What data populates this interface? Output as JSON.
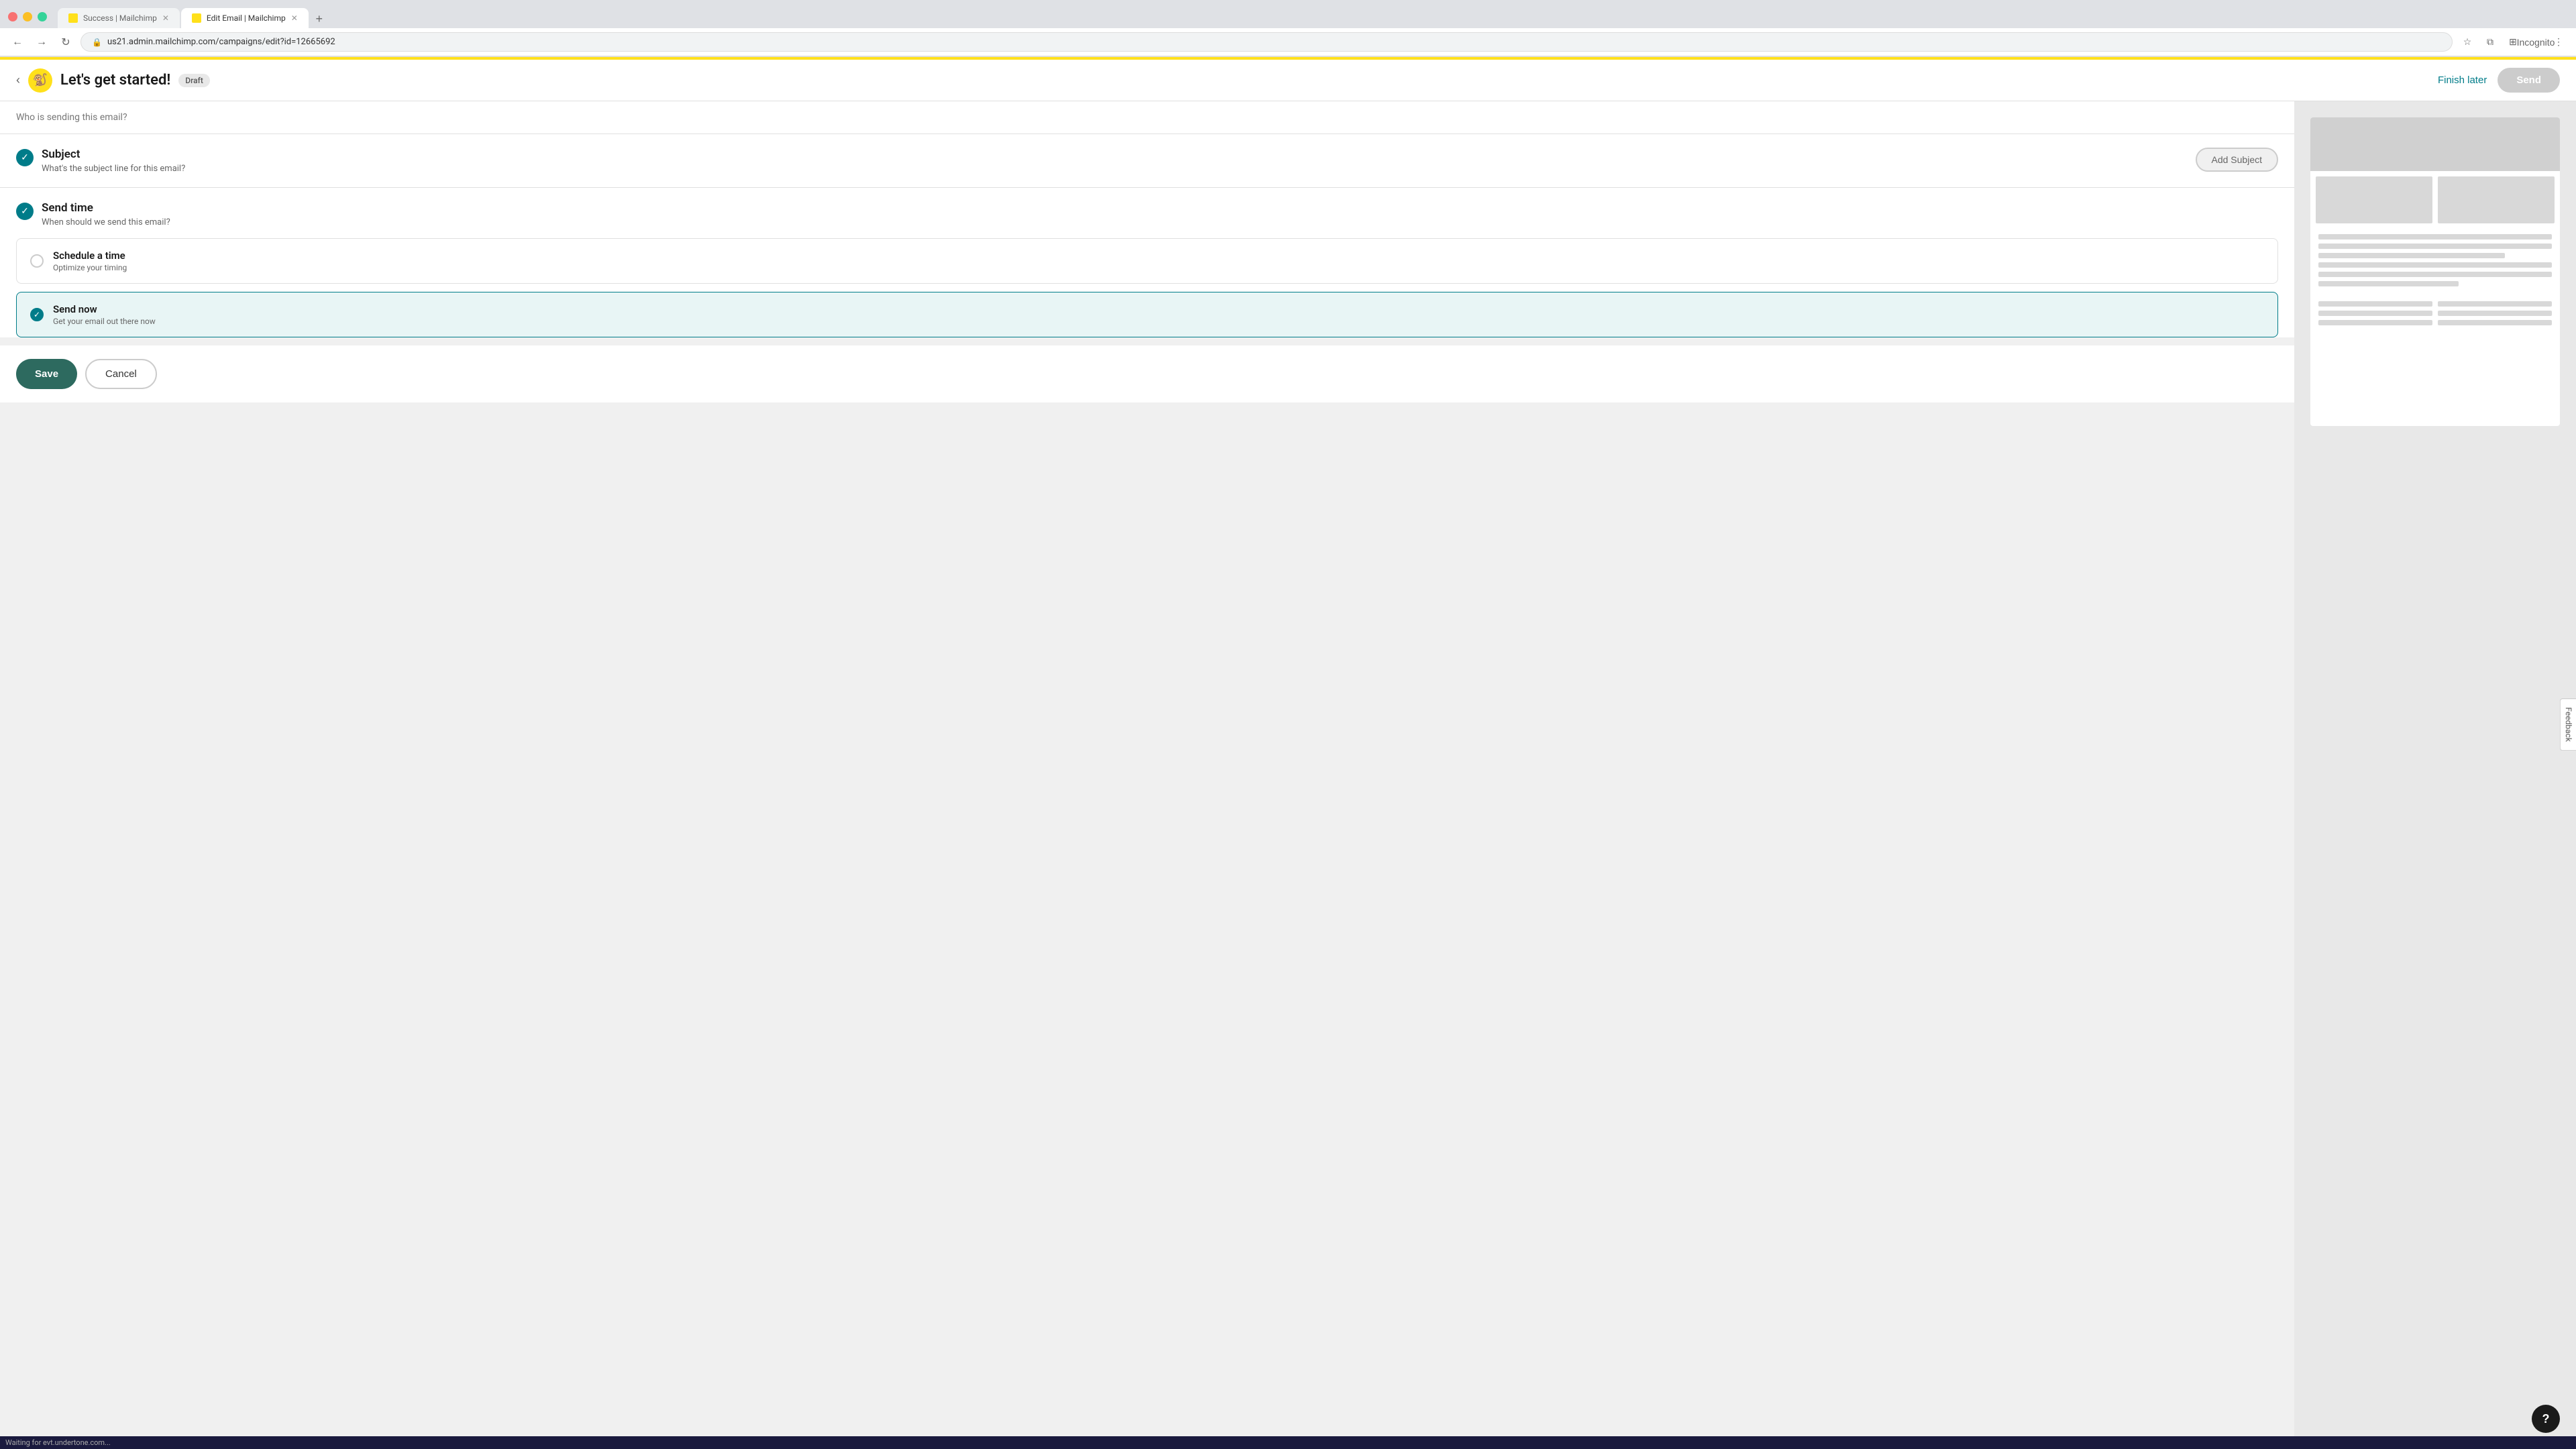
{
  "browser": {
    "tabs": [
      {
        "id": "tab1",
        "title": "Success | Mailchimp",
        "active": false,
        "favicon": "mailchimp"
      },
      {
        "id": "tab2",
        "title": "Edit Email | Mailchimp",
        "active": true,
        "favicon": "mailchimp"
      }
    ],
    "url": "us21.admin.mailchimp.com/campaigns/edit?id=12665692",
    "new_tab_label": "+",
    "toolbar": {
      "back": "←",
      "forward": "→",
      "refresh": "↻",
      "lock_icon": "🔒",
      "star": "☆",
      "profile": "Incognito",
      "menu": "⋮",
      "extensions": "⊞",
      "split": "⧉"
    }
  },
  "app": {
    "back_label": "‹",
    "logo_emoji": "🐒",
    "title": "Let's get started!",
    "draft_badge": "Draft",
    "finish_later_label": "Finish later",
    "send_label": "Send"
  },
  "sections": {
    "sender": {
      "question": "Who is sending this email?"
    },
    "subject": {
      "check_status": "completed",
      "title": "Subject",
      "description": "What's the subject line for this email?",
      "add_btn_label": "Add Subject"
    },
    "send_time": {
      "check_status": "completed",
      "title": "Send time",
      "description": "When should we send this email?",
      "options": [
        {
          "id": "schedule",
          "label": "Schedule a time",
          "sublabel": "Optimize your timing",
          "selected": false
        },
        {
          "id": "send_now",
          "label": "Send now",
          "sublabel": "Get your email out there now",
          "selected": true
        }
      ]
    }
  },
  "actions": {
    "save_label": "Save",
    "cancel_label": "Cancel"
  },
  "sidebar": {
    "feedback_label": "Feedback"
  },
  "help": {
    "label": "?"
  },
  "status_bar": {
    "text": "Waiting for evt.undertone.com..."
  }
}
